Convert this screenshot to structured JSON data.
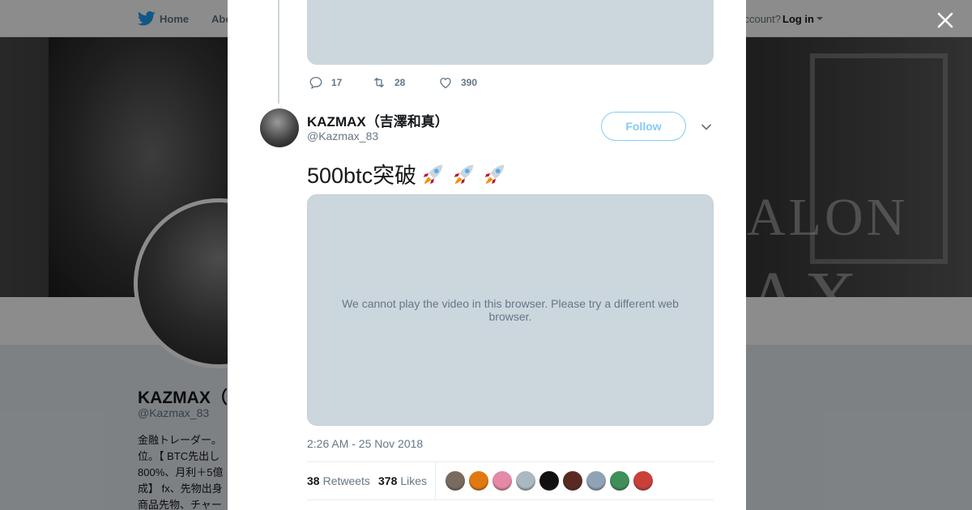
{
  "nav": {
    "home_label": "Home",
    "about_label": "Abo",
    "account_prompt": "account?",
    "login_label": "Log in"
  },
  "banner": {
    "text_line1": "ALON",
    "text_line2": "AX"
  },
  "profile": {
    "name": "KAZMAX（",
    "handle": "@Kazmax_83",
    "bio_lines": [
      "金融トレーダー。",
      "位。【 BTC先出し",
      "800%、月利＋5億",
      "成】 fx、先物出身",
      "商品先物、チャー"
    ]
  },
  "previous_tweet": {
    "reply_count": "17",
    "retweet_count": "28",
    "like_count": "390"
  },
  "tweet": {
    "author_name": "KAZMAX（吉澤和真）",
    "author_handle": "@Kazmax_83",
    "follow_label": "Follow",
    "text": "500btc突破",
    "video_message": "We cannot play the video in this browser. Please try a different web browser.",
    "timestamp": "2:26 AM - 25 Nov 2018",
    "retweets_count": "38",
    "retweets_label": "Retweets",
    "likes_count": "378",
    "likes_label": "Likes"
  },
  "likers": [
    {
      "name": "liker-1",
      "color": "#7b6a5e"
    },
    {
      "name": "liker-2",
      "color": "#e07a10"
    },
    {
      "name": "liker-3",
      "color": "#e58aa6"
    },
    {
      "name": "liker-4",
      "color": "#aab8c2"
    },
    {
      "name": "liker-5",
      "color": "#111111"
    },
    {
      "name": "liker-6",
      "color": "#5a2a22"
    },
    {
      "name": "liker-7",
      "color": "#8fa3b5"
    },
    {
      "name": "liker-8",
      "color": "#3f8f5a"
    },
    {
      "name": "liker-9",
      "color": "#c9403a"
    }
  ],
  "colors": {
    "accent": "#1da1f2",
    "media_placeholder": "#ccd6dd",
    "secondary_text": "#657786"
  }
}
